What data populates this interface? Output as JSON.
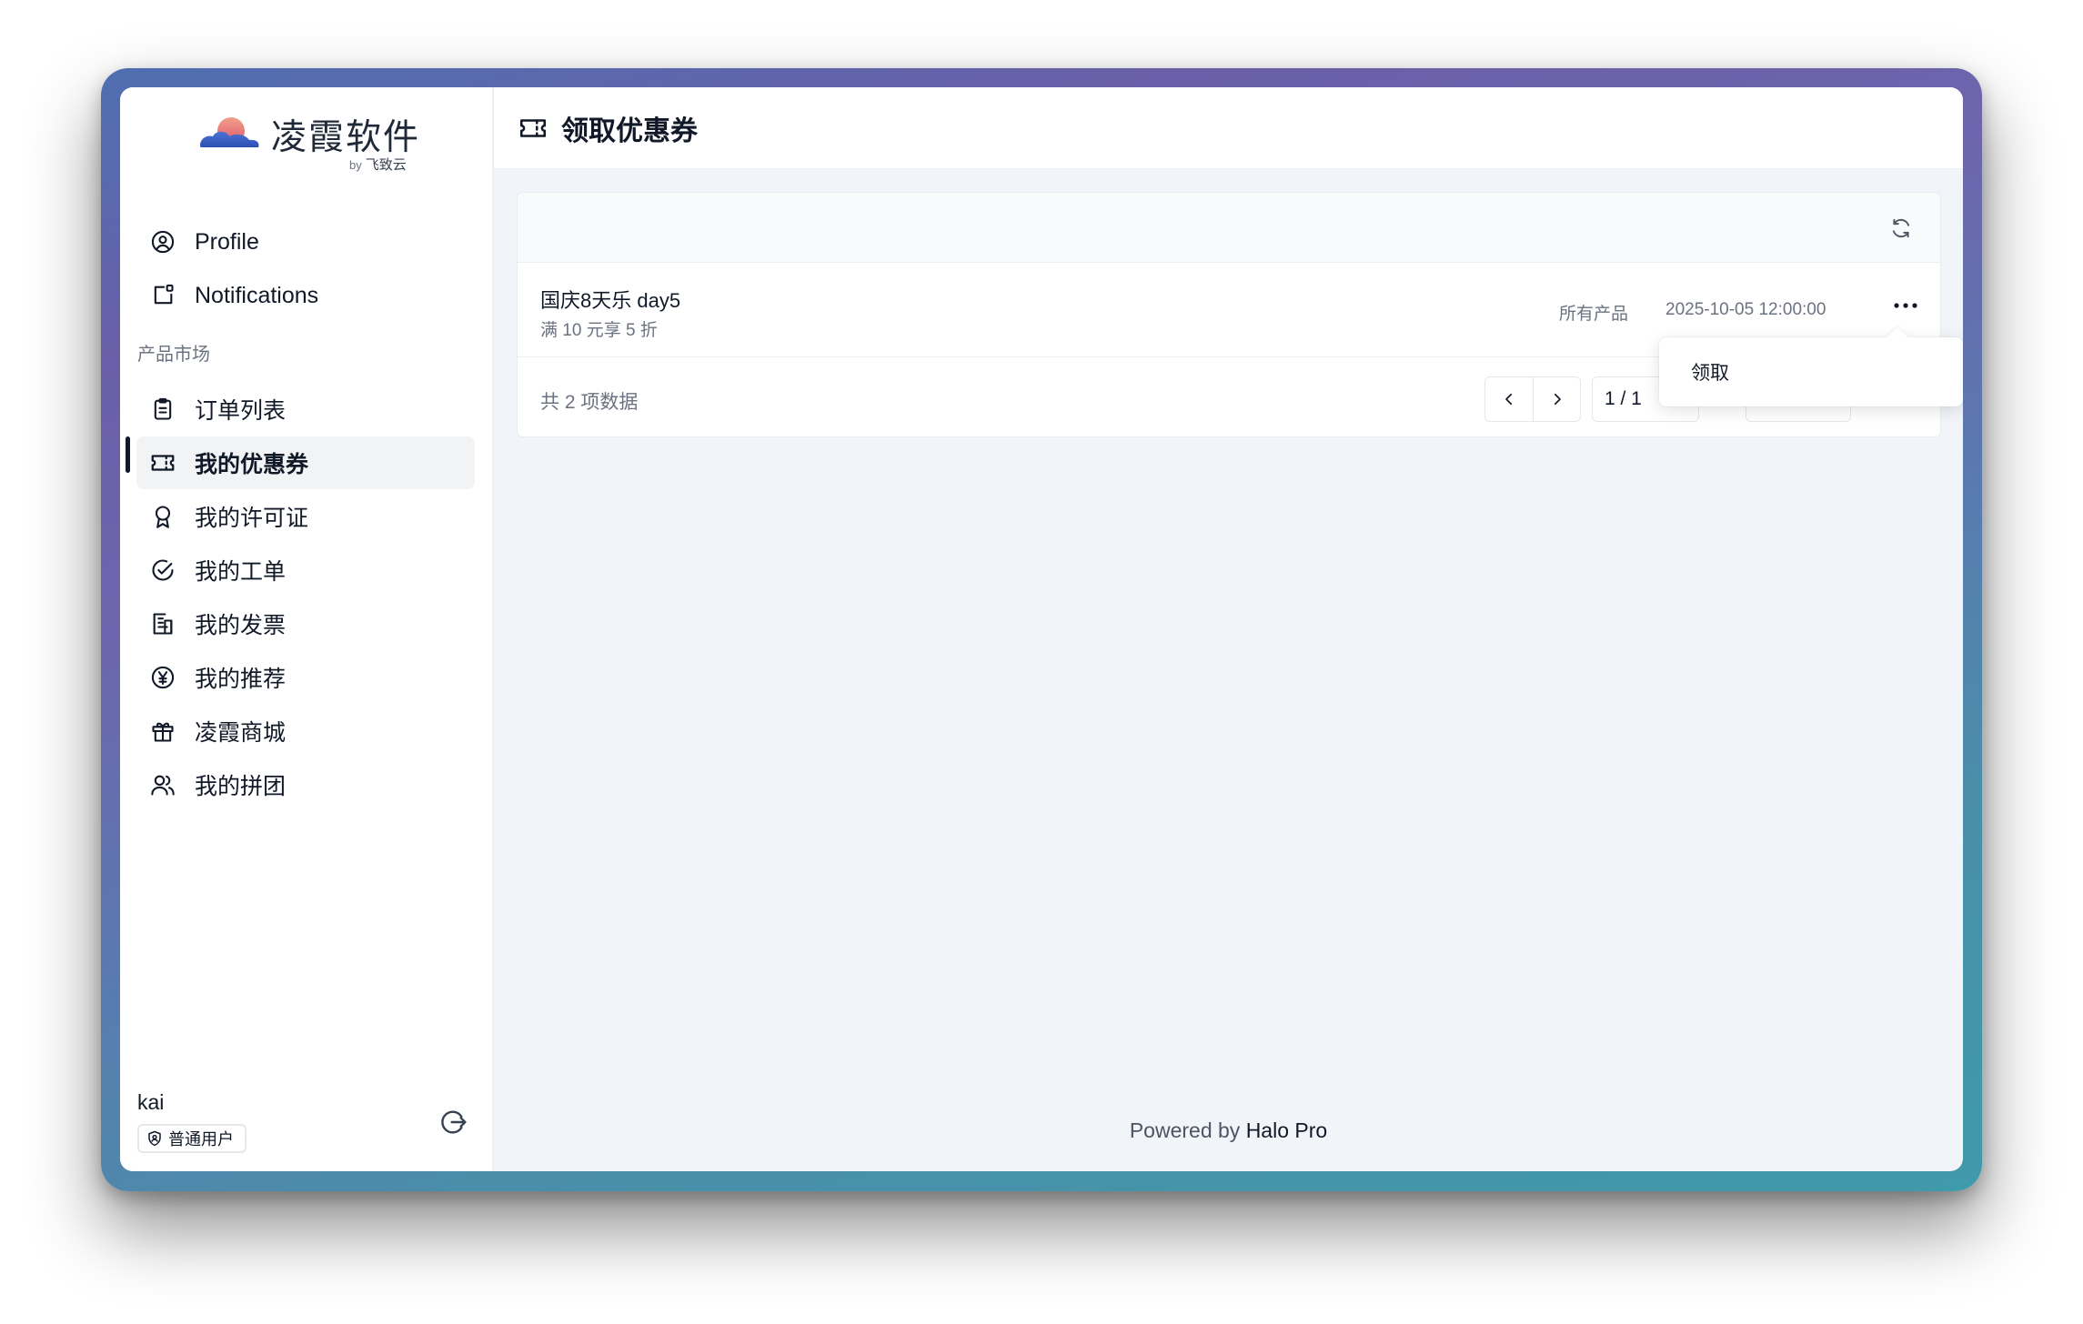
{
  "app": {
    "logo_text": "凌霞软件",
    "logo_by": "by",
    "logo_company": "飞致云"
  },
  "sidebar": {
    "top_items": [
      {
        "label": "Profile",
        "icon": "user-circle-icon"
      },
      {
        "label": "Notifications",
        "icon": "notification-icon"
      }
    ],
    "section_label": "产品市场",
    "items": [
      {
        "label": "订单列表",
        "icon": "clipboard-icon",
        "active": false
      },
      {
        "label": "我的优惠券",
        "icon": "ticket-icon",
        "active": true
      },
      {
        "label": "我的许可证",
        "icon": "award-icon",
        "active": false
      },
      {
        "label": "我的工单",
        "icon": "check-circle-icon",
        "active": false
      },
      {
        "label": "我的发票",
        "icon": "receipt-icon",
        "active": false
      },
      {
        "label": "我的推荐",
        "icon": "yen-circle-icon",
        "active": false
      },
      {
        "label": "凌霞商城",
        "icon": "gift-icon",
        "active": false
      },
      {
        "label": "我的拼团",
        "icon": "users-icon",
        "active": false
      }
    ],
    "user": {
      "name": "kai",
      "role": "普通用户"
    }
  },
  "header": {
    "title": "领取优惠券",
    "icon": "ticket-icon"
  },
  "coupons": [
    {
      "title": "国庆8天乐 day5",
      "subtitle": "满 10 元享 5 折",
      "scope": "所有产品",
      "date": "2025-10-05 12:00:00"
    }
  ],
  "pagination": {
    "total_text": "共 2 项数据",
    "page_text": "1 / 1"
  },
  "dropdown": {
    "claim_label": "领取"
  },
  "footer": {
    "powered_prefix": "Powered by ",
    "powered_brand": "Halo Pro"
  },
  "colors": {
    "accent": "#111827",
    "frame_top": "#6a5fa8",
    "frame_bottom": "#3f9aab"
  }
}
